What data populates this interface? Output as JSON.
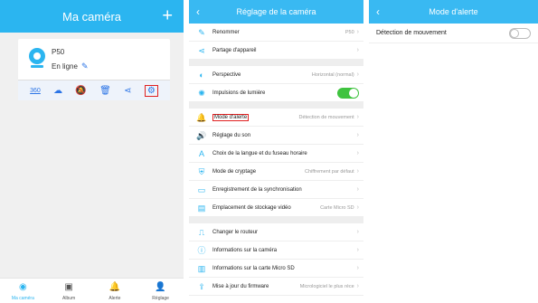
{
  "colors": {
    "header": "#2bb5f0",
    "accent": "#2b74e6",
    "toggle_on": "#3fc33f",
    "highlight": "#e02020"
  },
  "camera_list": {
    "title": "Ma caméra",
    "add_icon": "+",
    "camera": {
      "name": "P50",
      "status": "En ligne"
    },
    "actions": [
      "360-view-icon",
      "cloud-icon",
      "alarm-off-icon",
      "trash-icon",
      "share-icon",
      "gear-icon"
    ],
    "action_360_label": "360",
    "nav": [
      {
        "label": "Ma caméra",
        "icon": "camera-icon",
        "active": true
      },
      {
        "label": "Album",
        "icon": "album-icon",
        "active": false
      },
      {
        "label": "Alerte",
        "icon": "bell-icon",
        "active": false
      },
      {
        "label": "Réglage",
        "icon": "user-icon",
        "active": false
      }
    ]
  },
  "settings": {
    "title": "Réglage de la caméra",
    "items": [
      {
        "label": "Renommer",
        "value": "P50",
        "icon": "edit-icon"
      },
      {
        "label": "Partage d'appareil",
        "value": "",
        "icon": "share-icon"
      },
      {
        "label": "Perspective",
        "value": "Horizontal (normal)",
        "icon": "perspective-icon"
      },
      {
        "label": "Impulsions de lumière",
        "value": "",
        "icon": "light-icon",
        "toggle": true
      },
      {
        "label": "Mode d'alerte",
        "value": "Détection de mouvement",
        "icon": "bell-icon",
        "highlighted": true
      },
      {
        "label": "Réglage du son",
        "value": "",
        "icon": "sound-icon"
      },
      {
        "label": "Choix de la langue et du fuseau horaire",
        "value": "",
        "icon": "language-icon"
      },
      {
        "label": "Mode de cryptage",
        "value": "Chiffrement par défaut",
        "icon": "shield-icon"
      },
      {
        "label": "Enregistrement de la synchronisation",
        "value": "",
        "icon": "video-icon"
      },
      {
        "label": "Emplacement de stockage vidéo",
        "value": "Carte Micro SD",
        "icon": "storage-icon"
      },
      {
        "label": "Changer le routeur",
        "value": "",
        "icon": "router-icon"
      },
      {
        "label": "Informations sur la caméra",
        "value": "",
        "icon": "info-icon"
      },
      {
        "label": "Informations sur la carte Micro SD",
        "value": "",
        "icon": "sd-card-icon"
      },
      {
        "label": "Mise à jour du firmware",
        "value": "Micrologiciel le plus réce",
        "icon": "upload-icon"
      }
    ]
  },
  "alert_mode": {
    "title": "Mode d'alerte",
    "motion_detection_label": "Détection de mouvement",
    "motion_detection_enabled": false
  }
}
